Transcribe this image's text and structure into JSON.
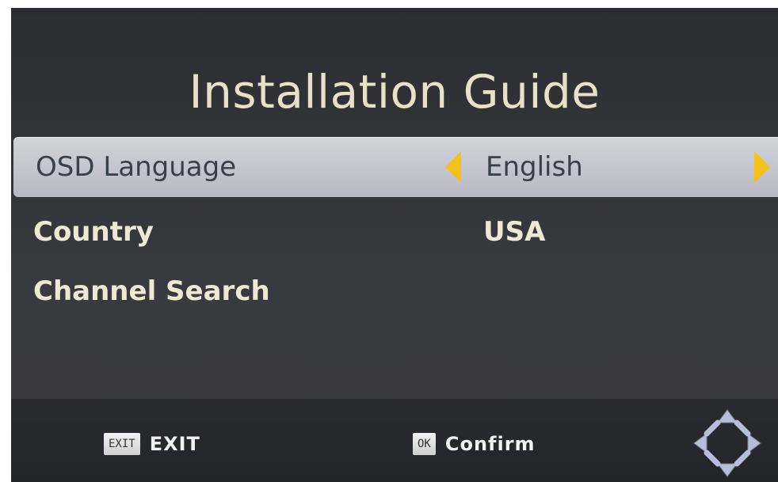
{
  "title": "Installation Guide",
  "menu": [
    {
      "label": "OSD Language",
      "value": "English"
    },
    {
      "label": "Country",
      "value": "USA"
    },
    {
      "label": "Channel Search",
      "value": ""
    }
  ],
  "footer": {
    "exit_badge": "EXIT",
    "exit_label": "EXIT",
    "ok_badge": "OK",
    "ok_label": "Confirm"
  },
  "icons": [
    "left-arrow-icon",
    "right-arrow-icon",
    "exit-key-icon",
    "ok-key-icon",
    "dpad-icon"
  ],
  "colors": {
    "accent_arrow": "#f2c21a",
    "selected_row": "#c4c4cf",
    "text_light": "#ece9d4",
    "title_text": "#e6e2c8"
  }
}
